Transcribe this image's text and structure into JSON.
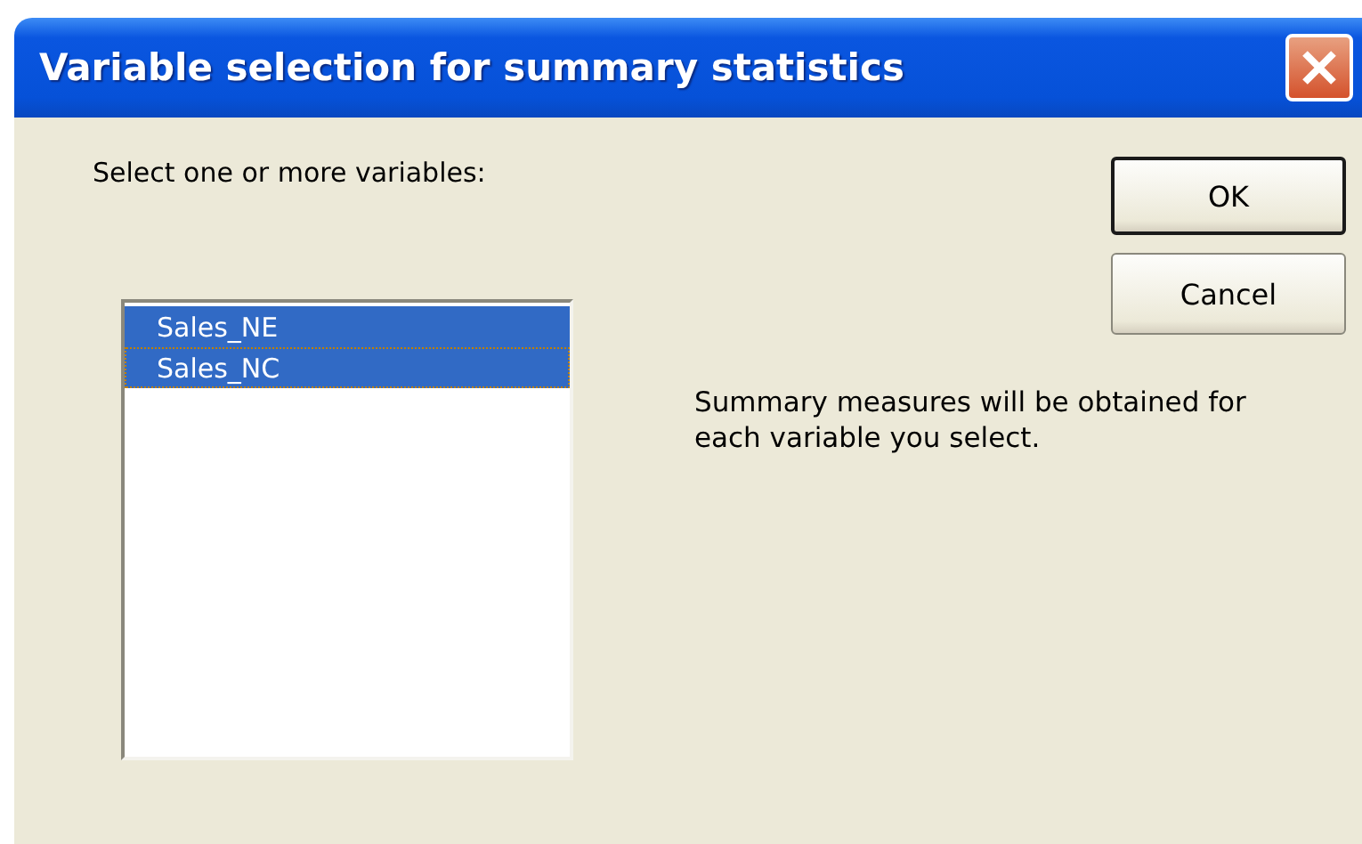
{
  "window": {
    "title": "Variable selection for summary statistics"
  },
  "prompt": "Select one or more variables:",
  "variables": [
    {
      "label": "Sales_NE",
      "selected": true,
      "focused": false
    },
    {
      "label": "Sales_NC",
      "selected": true,
      "focused": true
    }
  ],
  "note": "Summary measures will be obtained for each variable you select.",
  "buttons": [
    {
      "label": "OK",
      "default": true
    },
    {
      "label": "Cancel",
      "default": false
    }
  ]
}
